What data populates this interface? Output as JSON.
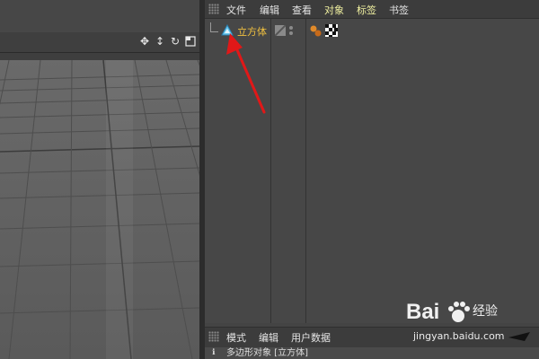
{
  "object_manager": {
    "menu": [
      "文件",
      "编辑",
      "查看",
      "对象",
      "标签",
      "书签"
    ],
    "object_name": "立方体"
  },
  "attribute_manager": {
    "menu": [
      "模式",
      "编辑",
      "用户数据"
    ],
    "info_text": "多边形对象 [立方体]"
  },
  "watermark": {
    "brand": "Bai",
    "brand2": "du",
    "service": "经验",
    "url": "jingyan.baidu.com"
  },
  "colors": {
    "highlight": "#f0c040",
    "menu_highlight": "#f0f0a0",
    "arrow": "#e01818"
  },
  "icons": [
    "move-icon",
    "arrow-icon",
    "rotate-icon",
    "maximize-icon",
    "cube-object-icon",
    "render-visibility-icon",
    "material-tag-icon",
    "texture-tag-icon"
  ]
}
